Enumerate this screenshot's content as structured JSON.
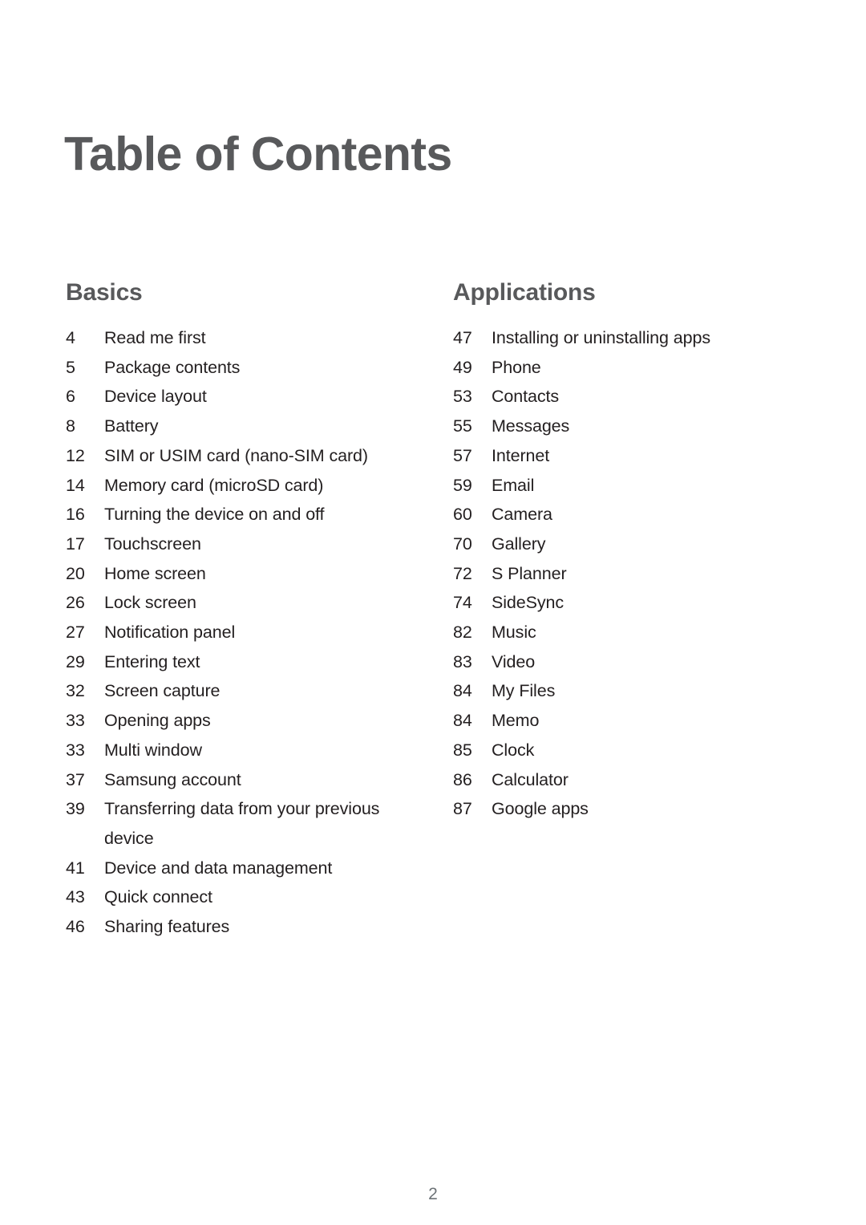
{
  "document": {
    "title": "Table of Contents",
    "folio": "2",
    "title_color": "#58595b",
    "body_color": "#231f20",
    "folio_color": "#6d7377",
    "background_color": "#ffffff"
  },
  "columns": [
    {
      "heading": "Basics",
      "entries": [
        {
          "page": "4",
          "label": "Read me first"
        },
        {
          "page": "5",
          "label": "Package contents"
        },
        {
          "page": "6",
          "label": "Device layout"
        },
        {
          "page": "8",
          "label": "Battery"
        },
        {
          "page": "12",
          "label": "SIM or USIM card (nano-SIM card)"
        },
        {
          "page": "14",
          "label": "Memory card (microSD card)"
        },
        {
          "page": "16",
          "label": "Turning the device on and off"
        },
        {
          "page": "17",
          "label": "Touchscreen"
        },
        {
          "page": "20",
          "label": "Home screen"
        },
        {
          "page": "26",
          "label": "Lock screen"
        },
        {
          "page": "27",
          "label": "Notification panel"
        },
        {
          "page": "29",
          "label": "Entering text"
        },
        {
          "page": "32",
          "label": "Screen capture"
        },
        {
          "page": "33",
          "label": "Opening apps"
        },
        {
          "page": "33",
          "label": "Multi window"
        },
        {
          "page": "37",
          "label": "Samsung account"
        },
        {
          "page": "39",
          "label": "Transferring data from your previous device"
        },
        {
          "page": "41",
          "label": "Device and data management"
        },
        {
          "page": "43",
          "label": "Quick connect"
        },
        {
          "page": "46",
          "label": "Sharing features"
        }
      ]
    },
    {
      "heading": "Applications",
      "entries": [
        {
          "page": "47",
          "label": "Installing or uninstalling apps"
        },
        {
          "page": "49",
          "label": "Phone"
        },
        {
          "page": "53",
          "label": "Contacts"
        },
        {
          "page": "55",
          "label": "Messages"
        },
        {
          "page": "57",
          "label": "Internet"
        },
        {
          "page": "59",
          "label": "Email"
        },
        {
          "page": "60",
          "label": "Camera"
        },
        {
          "page": "70",
          "label": "Gallery"
        },
        {
          "page": "72",
          "label": "S Planner"
        },
        {
          "page": "74",
          "label": "SideSync"
        },
        {
          "page": "82",
          "label": "Music"
        },
        {
          "page": "83",
          "label": "Video"
        },
        {
          "page": "84",
          "label": "My Files"
        },
        {
          "page": "84",
          "label": "Memo"
        },
        {
          "page": "85",
          "label": "Clock"
        },
        {
          "page": "86",
          "label": "Calculator"
        },
        {
          "page": "87",
          "label": "Google apps"
        }
      ]
    }
  ]
}
